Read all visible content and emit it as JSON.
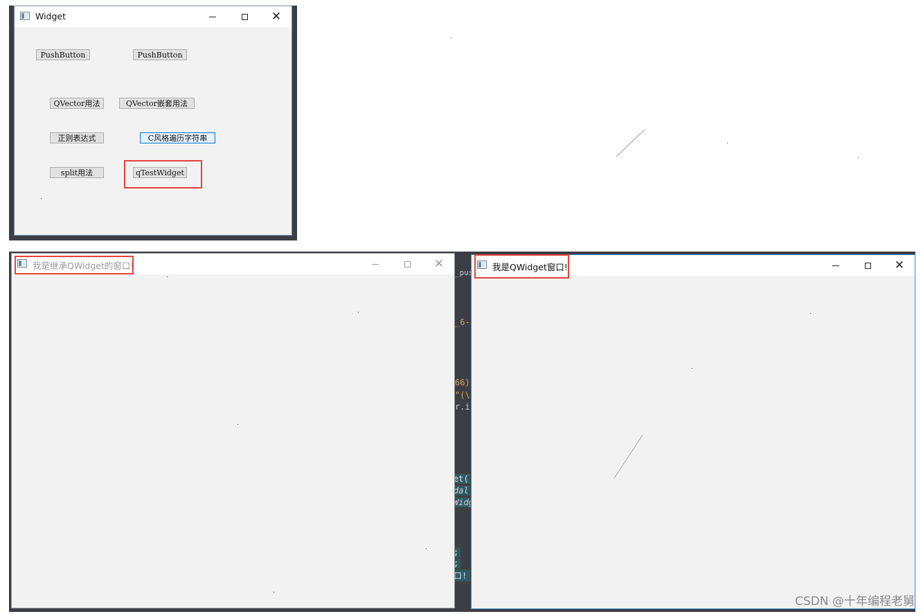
{
  "widget_window": {
    "title": "Widget",
    "buttons": {
      "pushbutton_1": "PushButton",
      "pushbutton_2": "PushButton",
      "qvector_usage": "QVector用法",
      "qvector_nested": "QVector嵌套用法",
      "regex": "正则表达式",
      "c_style_traverse": "C风格遍历字符串",
      "split_usage": "split用法",
      "qtest_widget": "qTestWidget"
    }
  },
  "inherited_window": {
    "title": "我是继承QWidget的窗口!"
  },
  "qwidget_window": {
    "title": "我是QWidget窗口!"
  },
  "ide_fragments": {
    "push": "_pus",
    "line_6": "_6-",
    "num_66": "66)",
    "quote": "\"(\\",
    "ri": "r.i",
    "et": "et(",
    "dal": "dal",
    "widg": "Widg",
    "semi1": ";",
    "semi2": ";",
    "kou": "口!"
  },
  "watermark": "CSDN @十年编程老舅",
  "colors": {
    "highlight_red": "#e8413e",
    "focus_blue": "#0078d7",
    "ide_bg": "#3b3f44"
  }
}
